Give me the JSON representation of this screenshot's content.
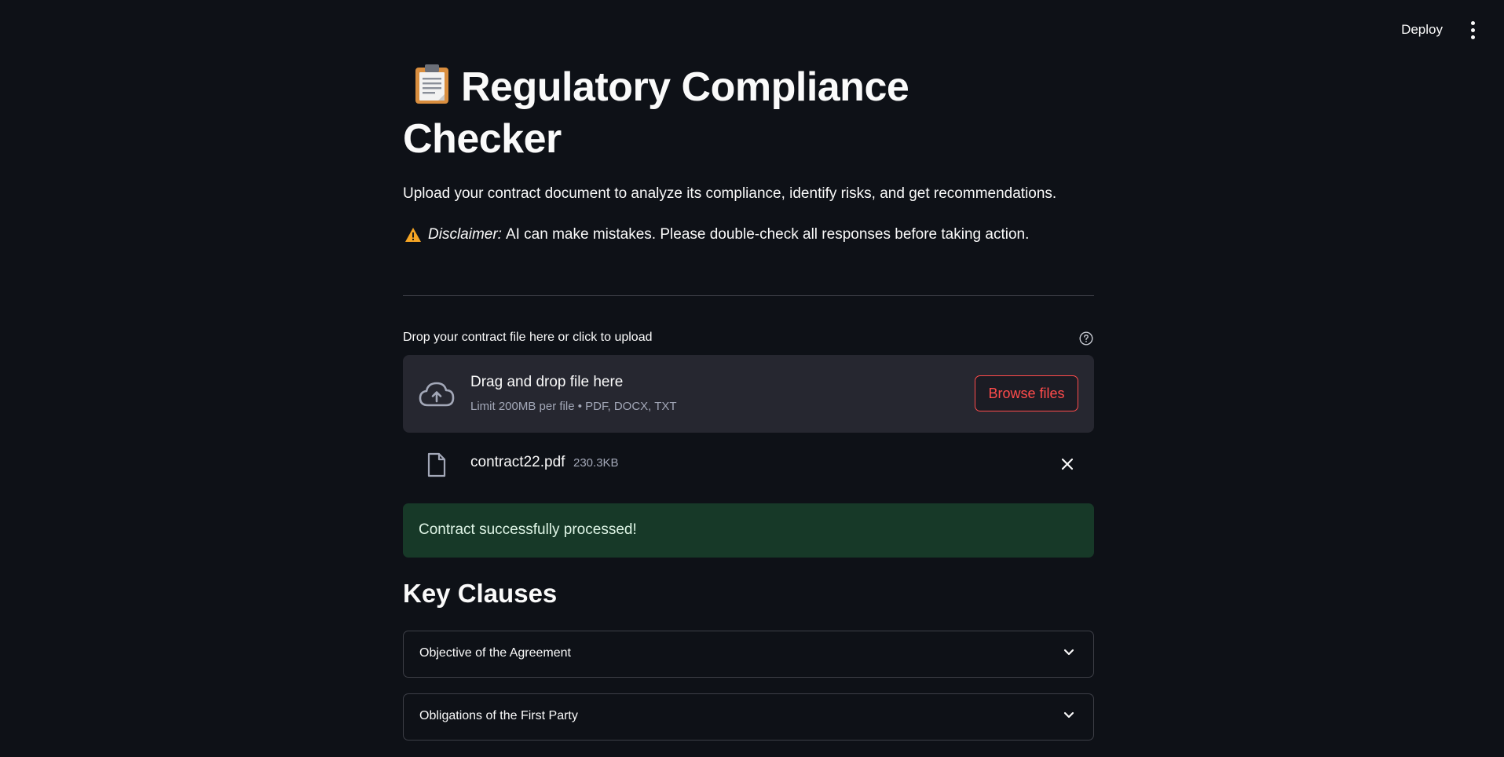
{
  "header": {
    "deploy_label": "Deploy",
    "menu_icon": "vertical-dots-icon"
  },
  "main": {
    "title_icon": "clipboard-icon",
    "title_line1": "Regulatory Compliance",
    "title_line2": "Checker",
    "intro": "Upload your contract document to analyze its compliance, identify risks, and get recommendations.",
    "disclaimer": {
      "icon": "warning-icon",
      "label": "Disclaimer:",
      "text": "AI can make mistakes. Please double-check all responses before taking action."
    }
  },
  "uploader": {
    "label": "Drop your contract file here or click to upload",
    "help_icon": "question-circle-icon",
    "dropzone_title": "Drag and drop file here",
    "dropzone_subtitle": "Limit 200MB per file • PDF, DOCX, TXT",
    "browse_label": "Browse files",
    "uploaded_file": {
      "name": "contract22.pdf",
      "size": "230.3KB"
    }
  },
  "status": {
    "message": "Contract successfully processed!",
    "color": "#173928"
  },
  "key_clauses": {
    "title": "Key Clauses",
    "items": [
      {
        "label": "Objective of the Agreement"
      },
      {
        "label": "Obligations of the First Party"
      }
    ]
  },
  "colors": {
    "background": "#0e1117",
    "accent": "#ff4b4b",
    "surface": "#262730"
  }
}
